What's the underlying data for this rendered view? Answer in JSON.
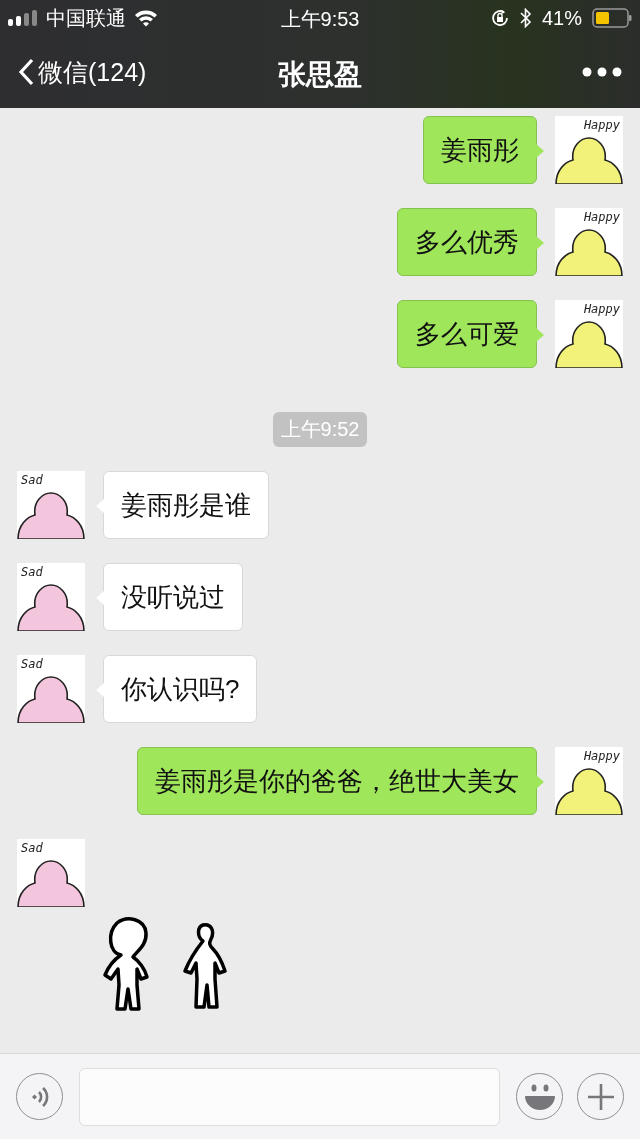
{
  "status_bar": {
    "carrier": "中国联通",
    "time": "上午9:53",
    "battery": "41%"
  },
  "nav": {
    "back": "微信(124)",
    "title": "张思盈"
  },
  "messages": [
    {
      "kind": "sent",
      "avatar": "Happy",
      "text": "姜雨彤"
    },
    {
      "kind": "sent",
      "avatar": "Happy",
      "text": "多么优秀"
    },
    {
      "kind": "sent",
      "avatar": "Happy",
      "text": "多么可爱"
    },
    {
      "kind": "time",
      "text": "上午9:52"
    },
    {
      "kind": "received",
      "avatar": "Sad",
      "text": "姜雨彤是谁"
    },
    {
      "kind": "received",
      "avatar": "Sad",
      "text": "没听说过"
    },
    {
      "kind": "received",
      "avatar": "Sad",
      "text": "你认识吗?"
    },
    {
      "kind": "sent",
      "avatar": "Happy",
      "text": "姜雨彤是你的爸爸，绝世大美女"
    },
    {
      "kind": "received_sticker",
      "avatar": "Sad"
    }
  ]
}
